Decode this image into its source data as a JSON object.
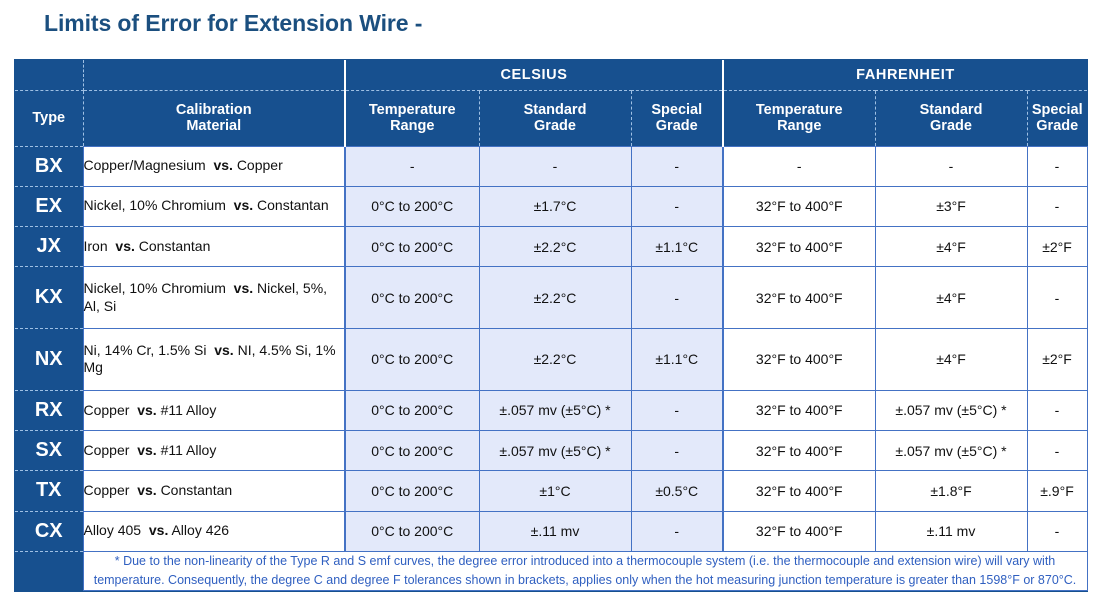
{
  "page_title": "Limits of Error for Extension Wire -",
  "colors": {
    "header_blue": "#17508f",
    "title_blue": "#1b4f7f",
    "celsius_cell_bg": "#e3e9fa",
    "fahrenheit_cell_bg": "#ffffff",
    "grid_blue": "#4472c4",
    "note_text": "#2f5fc0"
  },
  "table": {
    "group_headers": {
      "celsius": "CELSIUS",
      "fahrenheit": "FAHRENHEIT"
    },
    "columns": [
      "Type",
      "Calibration Material",
      "Temperature Range",
      "Standard Grade",
      "Special Grade",
      "Temperature Range",
      "Standard Grade",
      "Special Grade"
    ],
    "column_labels": {
      "type": "Type",
      "calibration_l1": "Calibration",
      "calibration_l2": "Material",
      "temp_range_l1": "Temperature",
      "temp_range_l2": "Range",
      "standard_l1": "Standard",
      "standard_l2": "Grade",
      "special_l1": "Special",
      "special_l2": "Grade",
      "f_temp_range_l1": "Temperature",
      "f_temp_range_l2": "Range",
      "f_standard_l1": "Standard",
      "f_standard_l2": "Grade",
      "f_special_l1": "Special",
      "f_special_l2": "Grade"
    },
    "rows": [
      {
        "type": "BX",
        "material_pre": "Copper/Magnesium",
        "material_vs": "vs.",
        "material_post": "Copper",
        "c_range": "-",
        "c_standard": "-",
        "c_special": "-",
        "f_range": "-",
        "f_standard": "-",
        "f_special": "-"
      },
      {
        "type": "EX",
        "material_pre": "Nickel, 10% Chromium",
        "material_vs": "vs.",
        "material_post": "Constantan",
        "c_range": "0°C to 200°C",
        "c_standard": "±1.7°C",
        "c_special": "-",
        "f_range": "32°F to 400°F",
        "f_standard": "±3°F",
        "f_special": "-"
      },
      {
        "type": "JX",
        "material_pre": "Iron",
        "material_vs": "vs.",
        "material_post": "Constantan",
        "c_range": "0°C to 200°C",
        "c_standard": "±2.2°C",
        "c_special": "±1.1°C",
        "f_range": "32°F to 400°F",
        "f_standard": "±4°F",
        "f_special": "±2°F"
      },
      {
        "type": "KX",
        "material_pre": "Nickel, 10% Chromium",
        "material_vs": "vs.",
        "material_post": "Nickel, 5%, Al, Si",
        "c_range": "0°C to 200°C",
        "c_standard": "±2.2°C",
        "c_special": "-",
        "f_range": "32°F to 400°F",
        "f_standard": "±4°F",
        "f_special": "-"
      },
      {
        "type": "NX",
        "material_pre": "Ni, 14% Cr, 1.5% Si",
        "material_vs": "vs.",
        "material_post": "NI, 4.5% Si, 1% Mg",
        "c_range": "0°C to 200°C",
        "c_standard": "±2.2°C",
        "c_special": "±1.1°C",
        "f_range": "32°F to 400°F",
        "f_standard": "±4°F",
        "f_special": "±2°F"
      },
      {
        "type": "RX",
        "material_pre": "Copper",
        "material_vs": "vs.",
        "material_post": "#11 Alloy",
        "c_range": "0°C to 200°C",
        "c_standard": "±.057 mv (±5°C) *",
        "c_special": "-",
        "f_range": "32°F to 400°F",
        "f_standard": "±.057 mv (±5°C) *",
        "f_special": "-"
      },
      {
        "type": "SX",
        "material_pre": "Copper",
        "material_vs": "vs.",
        "material_post": "#11 Alloy",
        "c_range": "0°C to 200°C",
        "c_standard": "±.057 mv (±5°C) *",
        "c_special": "-",
        "f_range": "32°F to 400°F",
        "f_standard": "±.057 mv (±5°C) *",
        "f_special": "-"
      },
      {
        "type": "TX",
        "material_pre": "Copper",
        "material_vs": "vs.",
        "material_post": "Constantan",
        "c_range": "0°C to 200°C",
        "c_standard": "±1°C",
        "c_special": "±0.5°C",
        "f_range": "32°F to 400°F",
        "f_standard": "±1.8°F",
        "f_special": "±.9°F"
      },
      {
        "type": "CX",
        "material_pre": "Alloy 405",
        "material_vs": "vs.",
        "material_post": "Alloy 426",
        "c_range": "0°C to 200°C",
        "c_standard": "±.11 mv",
        "c_special": "-",
        "f_range": "32°F to 400°F",
        "f_standard": "±.11 mv",
        "f_special": "-"
      }
    ],
    "footnote": "* Due to the non-linearity of the Type R and S emf curves, the degree error introduced into a thermocouple system (i.e. the thermocouple and extension wire)  will vary with temperature.   Consequently, the degree C and degree F tolerances shown in brackets, applies only when the hot measuring junction temperature is greater than 1598°F or 870°C."
  }
}
